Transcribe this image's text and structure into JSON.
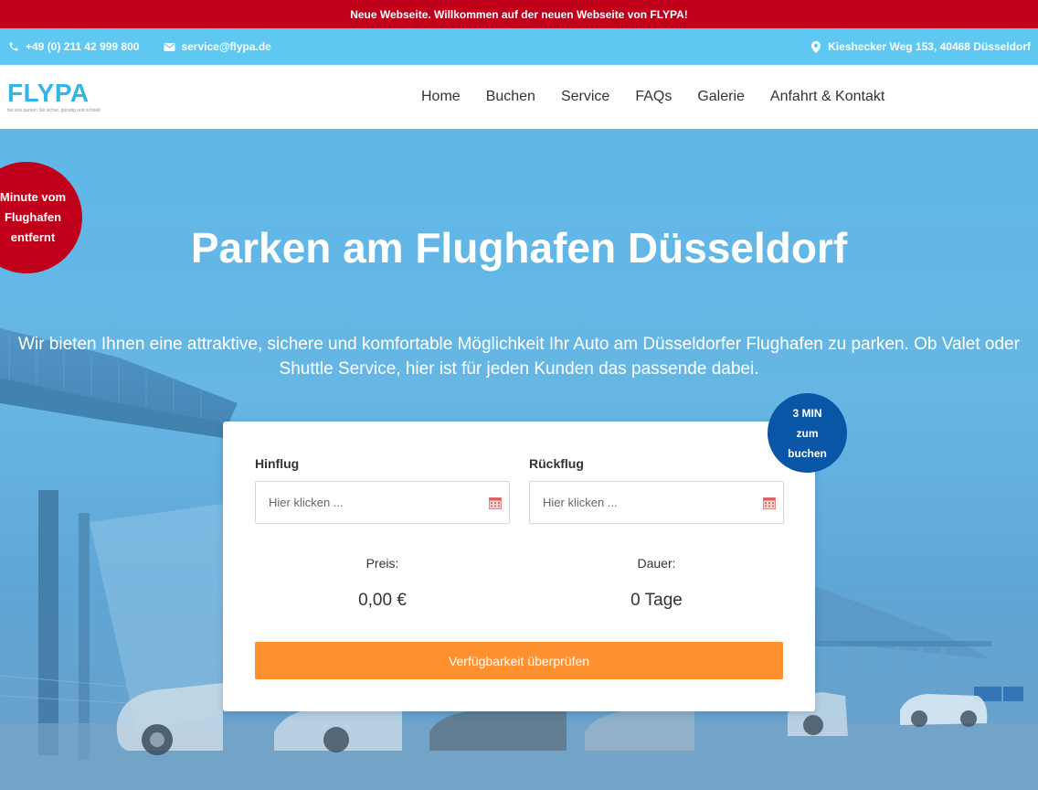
{
  "announcement": "Neue Webseite. Willkommen auf der neuen Webseite von FLYPA!",
  "contact": {
    "phone": "+49 (0) 211 42 999 800",
    "email": "service@flypa.de",
    "address": "Kieshecker Weg 153, 40468 Düsseldorf"
  },
  "logo": {
    "text": "FLYPA",
    "tagline": "bei uns parken Sie sicher, günstig und schnell"
  },
  "nav": {
    "items": [
      "Home",
      "Buchen",
      "Service",
      "FAQs",
      "Galerie",
      "Anfahrt & Kontakt"
    ]
  },
  "hero": {
    "badge_left": "Minute vom Flughafen entfernt",
    "title": "Parken am Flughafen Düsseldorf",
    "subtitle": "Wir bieten Ihnen eine attraktive, sichere und komfortable Möglichkeit Ihr Auto am Düsseldorfer Flughafen zu parken. Ob Valet oder Shuttle Service, hier ist für jeden Kunden das passende dabei.",
    "badge_right": "3 MIN zum buchen"
  },
  "booking": {
    "outbound_label": "Hinflug",
    "outbound_placeholder": "Hier klicken ...",
    "return_label": "Rückflug",
    "return_placeholder": "Hier klicken ...",
    "price_label": "Preis:",
    "price_value": "0,00 €",
    "duration_label": "Dauer:",
    "duration_value": "0 Tage",
    "submit_label": "Verfügbarkeit überprüfen"
  },
  "colors": {
    "announce_bg": "#c0001a",
    "infobar_bg": "#5fc8f2",
    "accent_orange": "#ff9030",
    "badge_blue": "#0a56a6",
    "logo_blue": "#33b5e5"
  },
  "icons": [
    "phone-icon",
    "mail-icon",
    "map-pin-icon",
    "calendar-icon"
  ]
}
